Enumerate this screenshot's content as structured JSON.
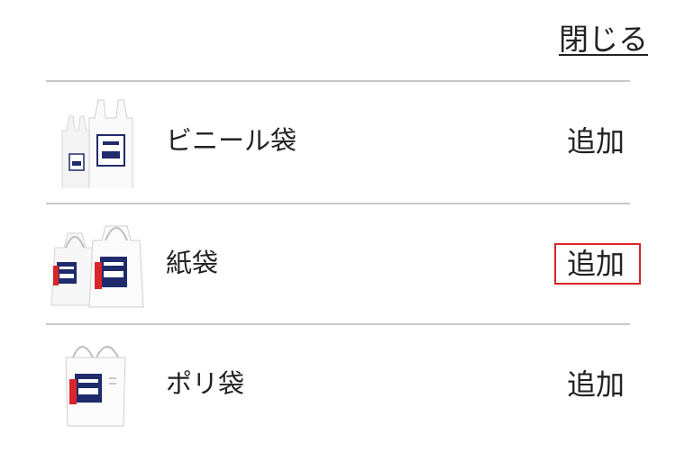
{
  "header": {
    "close_label": "閉じる"
  },
  "items": [
    {
      "label": "ビニール袋",
      "add_label": "追加",
      "icon": "plastic-bag-icon"
    },
    {
      "label": "紙袋",
      "add_label": "追加",
      "icon": "paper-bag-icon"
    },
    {
      "label": "ポリ袋",
      "add_label": "追加",
      "icon": "poly-bag-icon"
    }
  ],
  "colors": {
    "text": "#222222",
    "divider": "#c8c8c8",
    "highlight": "#d9252a",
    "logo_navy": "#1f2b6b",
    "logo_red": "#d9252a"
  },
  "highlighted_item": 1
}
